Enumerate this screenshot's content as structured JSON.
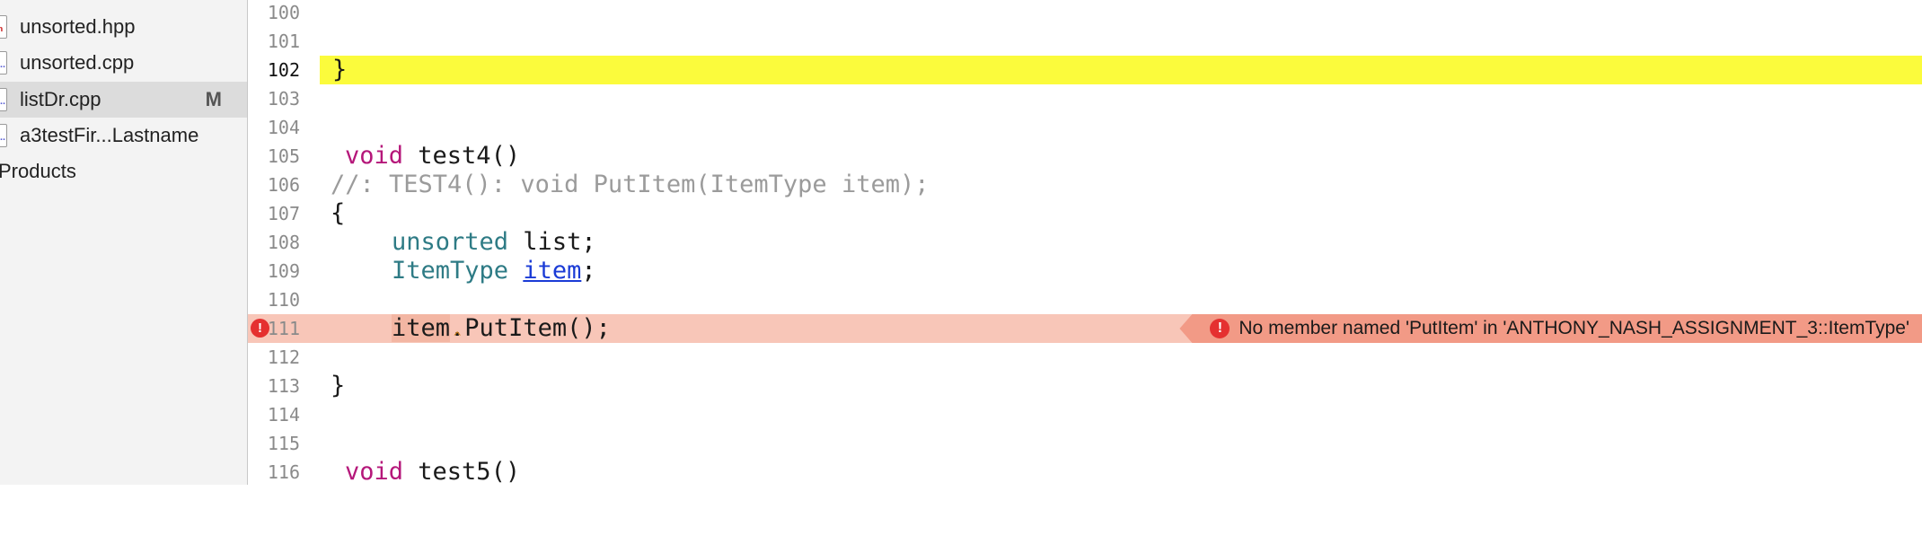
{
  "sidebar": {
    "items": [
      {
        "label": "unsorted.hpp",
        "icon": "h",
        "badge": ""
      },
      {
        "label": "unsorted.cpp",
        "icon": "c",
        "badge": ""
      },
      {
        "label": "listDr.cpp",
        "icon": "c",
        "badge": "M"
      },
      {
        "label": "a3testFir...Lastname",
        "icon": "c",
        "badge": ""
      }
    ],
    "group": "Products"
  },
  "gutter": {
    "lines": [
      "100",
      "101",
      "102",
      "103",
      "104",
      "105",
      "106",
      "107",
      "108",
      "109",
      "110",
      "111",
      "112",
      "113",
      "114",
      "115",
      "116"
    ]
  },
  "code": {
    "l102": "}",
    "l105_kw": "void",
    "l105_rest": " test4()",
    "l106": "//: TEST4(): void PutItem(ItemType item);",
    "l107": "{",
    "l108_type": "unsorted",
    "l108_rest": " list;",
    "l109_type": "ItemType",
    "l109_var": "item",
    "l109_end": ";",
    "l111_var": "item",
    "l111_dot": ".",
    "l111_rest": "PutItem();",
    "l113": "}",
    "l116_kw": "void",
    "l116_rest": " test5()"
  },
  "error": {
    "message": "No member named 'PutItem' in 'ANTHONY_NASH_ASSIGNMENT_3::ItemType'",
    "icon": "!"
  },
  "colors": {
    "current_line": "#fbfb3c",
    "error_line": "#f8c6b8",
    "error_banner": "#f29a86",
    "error_icon": "#e53030"
  }
}
